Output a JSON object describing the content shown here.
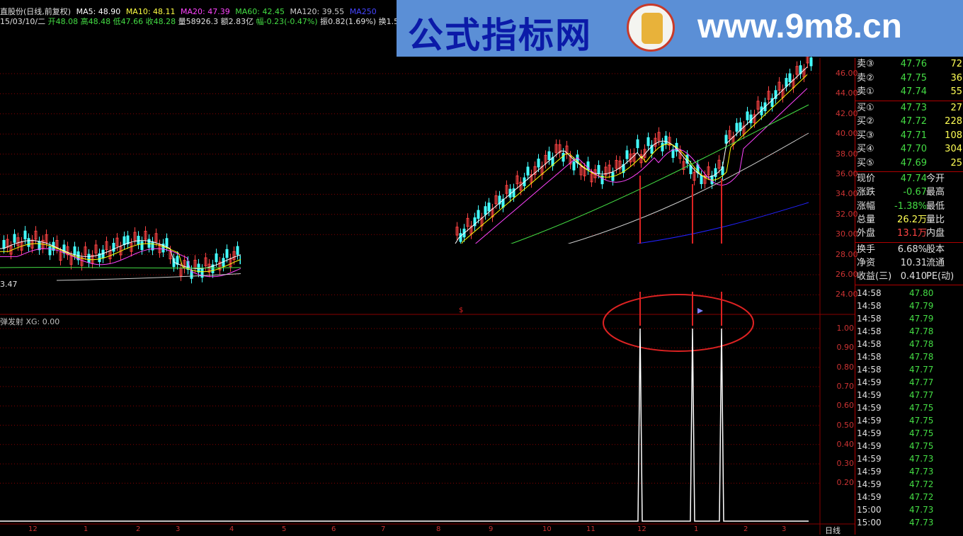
{
  "info": {
    "stock": "直股份(日线,前复权)",
    "ma5": "MA5: 48.90",
    "ma10": "MA10: 48.11",
    "ma20": "MA20: 47.39",
    "ma60": "MA60: 42.45",
    "ma120": "MA120: 39.55",
    "ma250": "MA250",
    "date": "15/03/10/二",
    "open": "开48.08",
    "high": "高48.48",
    "low": "低47.66",
    "close": "收48.28",
    "volume": "量58926.3",
    "amount": "额2.83亿",
    "change": "幅-0.23(-0.47%)",
    "amplitude": "振0.82(1.69%)",
    "turnover": "换1.5"
  },
  "banner": {
    "title": "公式指标网",
    "url": "www.9m8.cn"
  },
  "price_axis": [
    "46.00",
    "44.00",
    "42.00",
    "40.00",
    "38.00",
    "36.00",
    "34.00",
    "32.00",
    "30.00",
    "28.00",
    "26.00",
    "24.00"
  ],
  "indicator_axis": [
    "1.00",
    "0.90",
    "0.80",
    "0.70",
    "0.60",
    "0.50",
    "0.40",
    "0.30",
    "0.20"
  ],
  "low_marker": "3.47",
  "indicator": {
    "name": "弹发射",
    "xg": "XG: 0.00"
  },
  "x_axis": [
    "12",
    "1",
    "2",
    "3",
    "4",
    "5",
    "6",
    "7",
    "8",
    "9",
    "10",
    "11",
    "12",
    "1",
    "2",
    "3"
  ],
  "period": "日线",
  "quotes": {
    "asks": [
      {
        "label": "卖③",
        "price": "47.76",
        "vol": "72"
      },
      {
        "label": "卖②",
        "price": "47.75",
        "vol": "36"
      },
      {
        "label": "卖①",
        "price": "47.74",
        "vol": "55"
      }
    ],
    "bids": [
      {
        "label": "买①",
        "price": "47.73",
        "vol": "27"
      },
      {
        "label": "买②",
        "price": "47.72",
        "vol": "228"
      },
      {
        "label": "买③",
        "price": "47.71",
        "vol": "108"
      },
      {
        "label": "买④",
        "price": "47.70",
        "vol": "304"
      },
      {
        "label": "买⑤",
        "price": "47.69",
        "vol": "25"
      }
    ],
    "stats": [
      {
        "label": "现价",
        "value": "47.74",
        "label2": "今开",
        "color": "#44dd44"
      },
      {
        "label": "涨跌",
        "value": "-0.67",
        "label2": "最高",
        "color": "#44dd44"
      },
      {
        "label": "涨幅",
        "value": "-1.38%",
        "label2": "最低",
        "color": "#44dd44"
      },
      {
        "label": "总量",
        "value": "26.2万",
        "label2": "量比",
        "color": "#ffff55"
      },
      {
        "label": "外盘",
        "value": "13.1万",
        "label2": "内盘",
        "color": "#ff4444"
      }
    ],
    "stats2": [
      {
        "label": "换手",
        "value": "6.68%",
        "label2": "股本"
      },
      {
        "label": "净资",
        "value": "10.31",
        "label2": "流通"
      },
      {
        "label": "收益(三)",
        "value": "0.410",
        "label2": "PE(动)"
      }
    ],
    "ticks": [
      {
        "t": "14:58",
        "p": "47.80"
      },
      {
        "t": "14:58",
        "p": "47.79"
      },
      {
        "t": "14:58",
        "p": "47.79"
      },
      {
        "t": "14:58",
        "p": "47.78"
      },
      {
        "t": "14:58",
        "p": "47.78"
      },
      {
        "t": "14:58",
        "p": "47.78"
      },
      {
        "t": "14:58",
        "p": "47.77"
      },
      {
        "t": "14:59",
        "p": "47.77"
      },
      {
        "t": "14:59",
        "p": "47.77"
      },
      {
        "t": "14:59",
        "p": "47.75"
      },
      {
        "t": "14:59",
        "p": "47.75"
      },
      {
        "t": "14:59",
        "p": "47.75"
      },
      {
        "t": "14:59",
        "p": "47.75"
      },
      {
        "t": "14:59",
        "p": "47.73"
      },
      {
        "t": "14:59",
        "p": "47.73"
      },
      {
        "t": "14:59",
        "p": "47.72"
      },
      {
        "t": "14:59",
        "p": "47.72"
      },
      {
        "t": "15:00",
        "p": "47.73"
      },
      {
        "t": "15:00",
        "p": "47.73"
      }
    ]
  },
  "colors": {
    "ma5": "#ffffff",
    "ma10": "#ffff00",
    "ma20": "#ff44ff",
    "ma60": "#44dd44",
    "ma120": "#cccccc",
    "ma250": "#2222ff",
    "up": "#ff4444",
    "down": "#44ffff",
    "grid": "#8a0000",
    "highlight": "#dd2222"
  }
}
